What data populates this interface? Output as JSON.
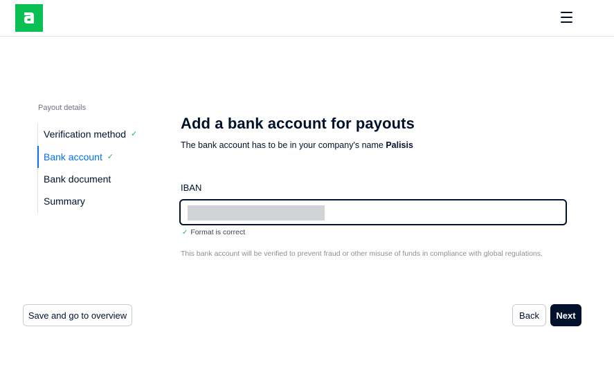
{
  "header": {
    "logo_icon": "adyen-logo-icon",
    "menu_icon": "hamburger-menu-icon",
    "brand_color": "#0abf53"
  },
  "sidebar": {
    "heading": "Payout details",
    "items": [
      {
        "label": "Verification method",
        "check": "✓"
      },
      {
        "label": "Bank account",
        "check": "✓"
      },
      {
        "label": "Bank document"
      },
      {
        "label": "Summary"
      }
    ]
  },
  "main": {
    "title": "Add a bank account for payouts",
    "subtitle_prefix": "The bank account has to be in your company's name ",
    "company_name": "Palisis",
    "iban_label": "IBAN",
    "iban_value_redacted": true,
    "validation_icon": "✓",
    "validation_message": "Format is correct",
    "disclaimer": "This bank account will be verified to prevent fraud or other misuse of funds in compliance with global regulations."
  },
  "footer": {
    "save_label": "Save and go to overview",
    "back_label": "Back",
    "next_label": "Next"
  }
}
